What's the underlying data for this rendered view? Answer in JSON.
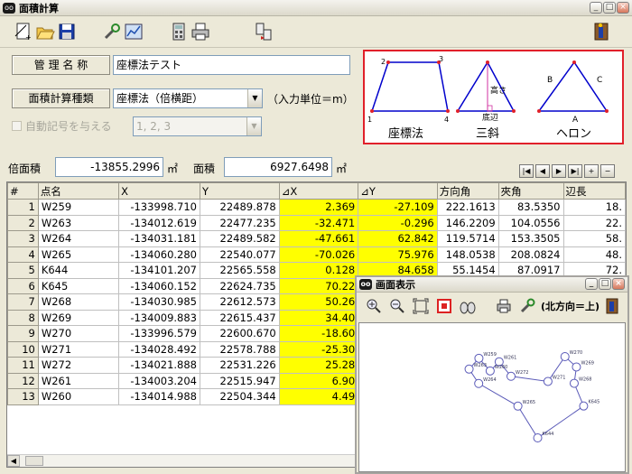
{
  "window": {
    "title": "面積計算"
  },
  "toolbar": {
    "icons": [
      "new-doc-icon",
      "open-folder-icon",
      "save-icon",
      "wrench-icon",
      "chart-icon",
      "calculator-icon",
      "printer-icon",
      "export-icon",
      "exit-icon"
    ]
  },
  "form": {
    "name_label": "管 理 名 称",
    "name_value": "座標法テスト",
    "calc_type_label": "面積計算種類",
    "calc_type_value": "座標法（倍横距）",
    "input_unit": "（入力単位＝m）",
    "auto_symbol_label": "自動記号を与える",
    "auto_symbol_value": "1, 2, 3"
  },
  "diagram": {
    "labels": {
      "zahyo": "座標法",
      "sanshaku": "三斜",
      "heron": "ヘロン",
      "takasa": "高さ",
      "teihen": "底辺",
      "p1": "1",
      "p2": "2",
      "p3": "3",
      "p4": "4",
      "a": "A",
      "b": "B",
      "c": "C"
    }
  },
  "summary": {
    "double_area_label": "倍面積",
    "double_area_value": "-13855.2996",
    "area_label": "面積",
    "area_value": "6927.6498",
    "unit": "㎡"
  },
  "nav": {
    "first": "|◀",
    "prev": "◀",
    "next": "▶",
    "last": "▶|",
    "add": "+",
    "remove": "−"
  },
  "table": {
    "headers": [
      "#",
      "点名",
      "X",
      "Y",
      "⊿X",
      "⊿Y",
      "方向角",
      "夾角",
      "辺長"
    ],
    "rows": [
      [
        "1",
        "W259",
        "-133998.710",
        "22489.878",
        "2.369",
        "-27.109",
        "222.1613",
        "83.5350",
        "18."
      ],
      [
        "2",
        "W263",
        "-134012.619",
        "22477.235",
        "-32.471",
        "-0.296",
        "146.2209",
        "104.0556",
        "22."
      ],
      [
        "3",
        "W264",
        "-134031.181",
        "22489.582",
        "-47.661",
        "62.842",
        "119.5714",
        "153.3505",
        "58."
      ],
      [
        "4",
        "W265",
        "-134060.280",
        "22540.077",
        "-70.026",
        "75.976",
        "148.0538",
        "208.0824",
        "48."
      ],
      [
        "5",
        "K644",
        "-134101.207",
        "22565.558",
        "0.128",
        "84.658",
        "55.1454",
        "87.0917",
        "72."
      ],
      [
        "6",
        "K645",
        "-134060.152",
        "22624.735",
        "70.22",
        "",
        "",
        "",
        ""
      ],
      [
        "7",
        "W268",
        "-134030.985",
        "22612.573",
        "50.26",
        "",
        "",
        "",
        ""
      ],
      [
        "8",
        "W269",
        "-134009.883",
        "22615.437",
        "34.40",
        "",
        "",
        "",
        ""
      ],
      [
        "9",
        "W270",
        "-133996.579",
        "22600.670",
        "-18.60",
        "",
        "",
        "",
        ""
      ],
      [
        "10",
        "W271",
        "-134028.492",
        "22578.788",
        "-25.30",
        "",
        "",
        "",
        ""
      ],
      [
        "11",
        "W272",
        "-134021.888",
        "22531.226",
        "25.28",
        "",
        "",
        "",
        ""
      ],
      [
        "12",
        "W261",
        "-134003.204",
        "22515.947",
        "6.90",
        "",
        "",
        "",
        ""
      ],
      [
        "13",
        "W260",
        "-134014.988",
        "22504.344",
        "4.49",
        "",
        "",
        "",
        ""
      ]
    ]
  },
  "subwindow": {
    "title": "画面表示",
    "north_label": "(北方向＝上)",
    "icons": [
      "zoom-in-icon",
      "zoom-out-icon",
      "fit-icon",
      "area-icon",
      "binoculars-icon",
      "printer-icon",
      "wrench-icon",
      "exit-icon"
    ],
    "points": [
      "W259",
      "W263",
      "W264",
      "W265",
      "K644",
      "K645",
      "W268",
      "W269",
      "W270",
      "W271",
      "W272",
      "W261",
      "W260"
    ]
  },
  "colors": {
    "highlight": "#ffff00",
    "diagram_border": "#e1202a",
    "diagram_line": "#0000cc"
  }
}
